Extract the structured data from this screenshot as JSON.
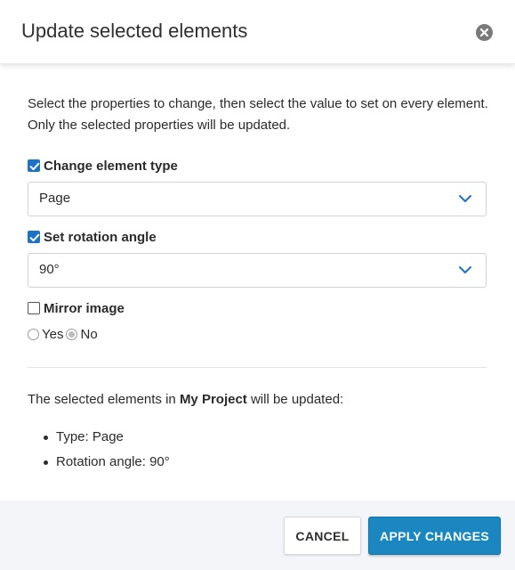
{
  "dialog": {
    "title": "Update selected elements",
    "close_icon": "close-icon"
  },
  "intro": {
    "line1": "Select the properties to change, then select the value to set on every element.",
    "line2": "Only the selected properties will be updated."
  },
  "fields": {
    "element_type": {
      "label": "Change element type",
      "checked": true,
      "value": "Page"
    },
    "rotation": {
      "label": "Set rotation angle",
      "checked": true,
      "value": "90°"
    },
    "mirror": {
      "label": "Mirror image",
      "checked": false,
      "options": [
        "Yes",
        "No"
      ],
      "selected": "No"
    }
  },
  "summary": {
    "prefix": "The selected elements in ",
    "project": "My Project",
    "suffix": " will be updated:",
    "items": [
      "Type: Page",
      "Rotation angle: 90°"
    ]
  },
  "footer": {
    "cancel_label": "CANCEL",
    "apply_label": "APPLY CHANGES"
  },
  "colors": {
    "accent": "#1a73c8",
    "primary_button": "#1b87c1",
    "footer_bg": "#f3f5f8"
  }
}
